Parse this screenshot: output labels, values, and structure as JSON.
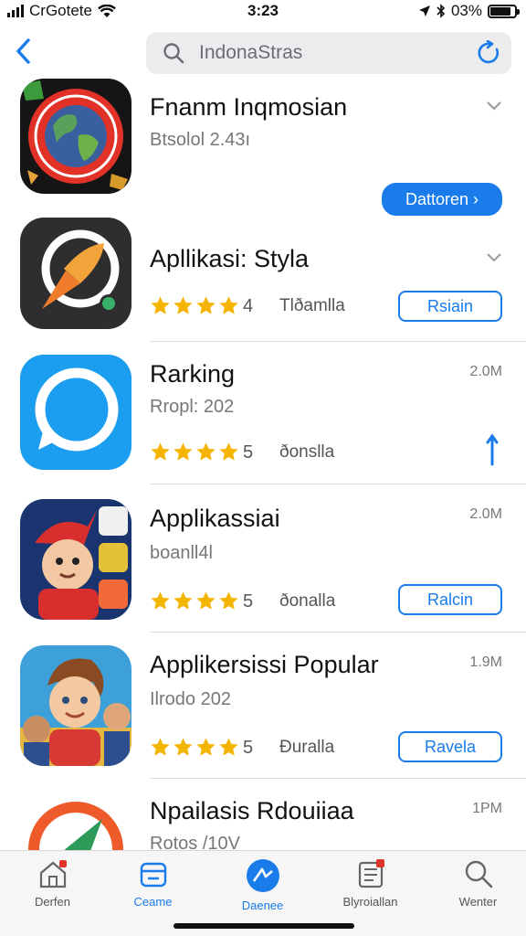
{
  "status_bar": {
    "carrier": "CrGotete",
    "time": "3:23",
    "battery": "03%",
    "battery_level": 0.85
  },
  "search": {
    "query": "IndonaStras"
  },
  "apps": [
    {
      "title": "Fnanm Inqmosian",
      "subtitle": "Btsolol 2.43ı",
      "action": "Dattoren ›"
    },
    {
      "title": "Apllikasi: Styla",
      "rating_text": "4",
      "rating": 4,
      "developer": "Tlðamlla",
      "action": "Rsiain"
    },
    {
      "title": "Rarking",
      "subtitle": "Rropl: 202",
      "size": "2.0M",
      "rating_text": "5",
      "rating": 4,
      "developer": "ðonslla"
    },
    {
      "title": "Applikassiai",
      "subtitle": "boanll4l",
      "size": "2.0M",
      "rating_text": "5",
      "rating": 4,
      "developer": "ðonalla",
      "action": "Ralcin"
    },
    {
      "title": "Applikersissi Popular",
      "subtitle": "Ilrodo 202",
      "size": "1.9M",
      "rating_text": "5",
      "rating": 4,
      "developer": "Ðuralla",
      "action": "Ravela"
    },
    {
      "title": "Npailasis Rdouiiaa",
      "subtitle": "Rotos /10V",
      "size": "1PM"
    }
  ],
  "tabs": [
    {
      "label": "Derfen",
      "icon": "home-icon"
    },
    {
      "label": "Ceame",
      "icon": "apps-icon",
      "active": true
    },
    {
      "label": "Daenee",
      "icon": "compass-icon"
    },
    {
      "label": "Blyroiallan",
      "icon": "library-icon"
    },
    {
      "label": "Wenter",
      "icon": "search-icon"
    }
  ],
  "colors": {
    "accent": "#1a7bea",
    "star": "#f5b400"
  }
}
